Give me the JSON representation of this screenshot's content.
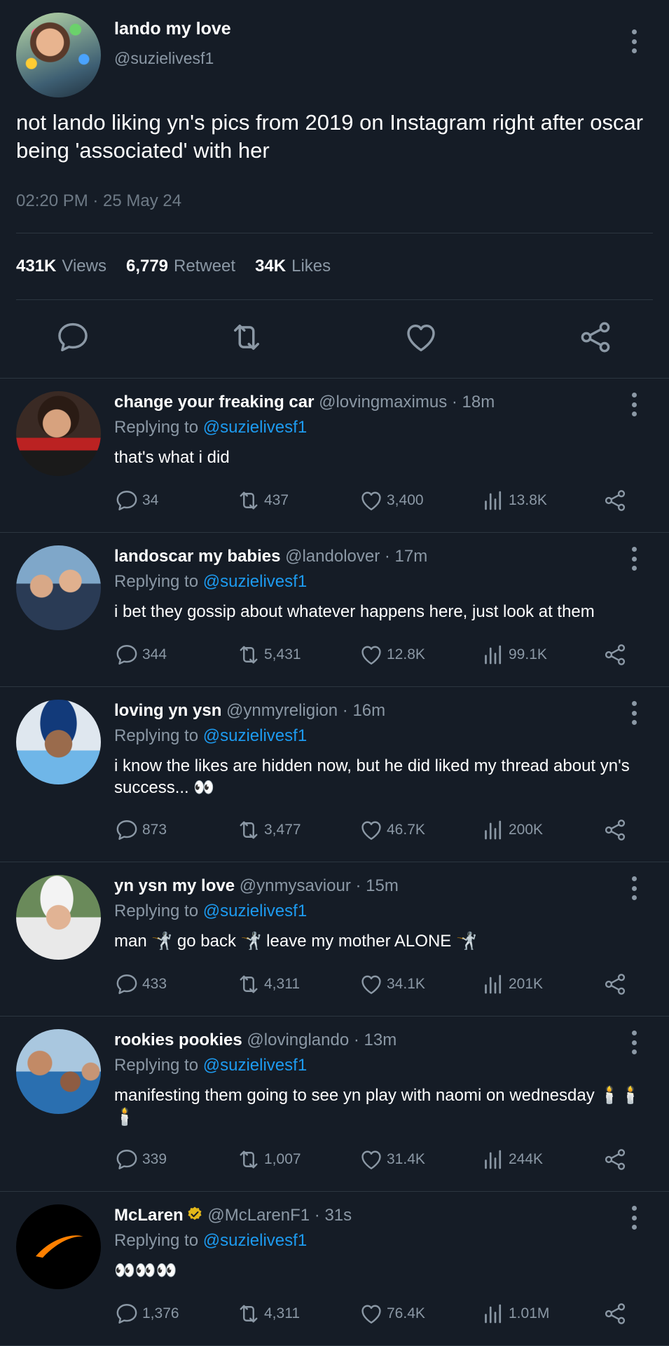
{
  "main": {
    "name": "lando my love",
    "handle": "@suzielivesf1",
    "text": "not lando liking yn's pics from 2019 on Instagram right after oscar being 'associated' with her",
    "timestamp": "02:20 PM · 25 May 24",
    "stats": {
      "views_value": "431K",
      "views_label": "Views",
      "retweet_value": "6,779",
      "retweet_label": "Retweet",
      "likes_value": "34K",
      "likes_label": "Likes"
    }
  },
  "replies": [
    {
      "name": "change your freaking car",
      "handle": "@lovingmaximus · 18m",
      "replying_label": "Replying to ",
      "replying_to": "@suzielivesf1",
      "text": "that's what i did",
      "reply_count": "34",
      "retweets": "437",
      "likes": "3,400",
      "views": "13.8K"
    },
    {
      "name": "landoscar my babies",
      "handle": "@landolover · 17m",
      "replying_label": "Replying to ",
      "replying_to": "@suzielivesf1",
      "text": "i bet they gossip about whatever happens here, just look at them",
      "reply_count": "344",
      "retweets": "5,431",
      "likes": "12.8K",
      "views": "99.1K"
    },
    {
      "name": "loving yn ysn",
      "handle": "@ynmyreligion · 16m",
      "replying_label": "Replying to ",
      "replying_to": "@suzielivesf1",
      "text": "i know the likes are hidden now, but he did liked my thread about yn's success... 👀",
      "reply_count": "873",
      "retweets": "3,477",
      "likes": "46.7K",
      "views": "200K"
    },
    {
      "name": "yn ysn my love",
      "handle": "@ynmysaviour · 15m",
      "replying_label": "Replying to ",
      "replying_to": "@suzielivesf1",
      "text": "man 🤺 go back 🤺 leave my mother ALONE 🤺",
      "reply_count": "433",
      "retweets": "4,311",
      "likes": "34.1K",
      "views": "201K"
    },
    {
      "name": "rookies pookies",
      "handle": "@lovinglando · 13m",
      "replying_label": "Replying to ",
      "replying_to": "@suzielivesf1",
      "text": "manifesting them going to see yn play with naomi on wednesday 🕯️🕯️🕯️",
      "reply_count": "339",
      "retweets": "1,007",
      "likes": "31.4K",
      "views": "244K"
    },
    {
      "name": "McLaren",
      "handle": "@McLarenF1 · 31s",
      "replying_label": "Replying to ",
      "replying_to": "@suzielivesf1",
      "text": "👀👀👀",
      "reply_count": "1,376",
      "retweets": "4,311",
      "likes": "76.4K",
      "views": "1.01M"
    }
  ],
  "icons": {
    "reply": "speech-bubble-icon",
    "retweet": "retweet-icon",
    "like": "heart-icon",
    "views": "bar-chart-icon",
    "share": "share-icon",
    "more": "kebab-icon",
    "verified": "gold-verified-badge-icon"
  },
  "colors": {
    "background": "#151c26",
    "text": "#ffffff",
    "muted": "#8b98a5",
    "link": "#1d9bf0",
    "verified": "#e2b719",
    "mclaren_orange": "#ff8000"
  }
}
